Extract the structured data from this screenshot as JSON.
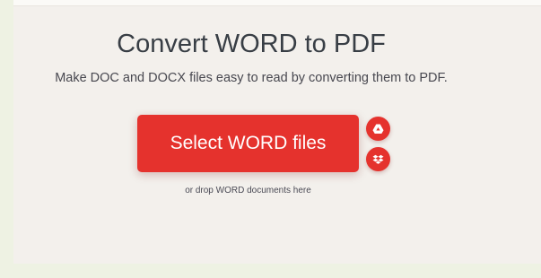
{
  "page": {
    "title": "Convert WORD to PDF",
    "subtitle": "Make DOC and DOCX files easy to read by converting them to PDF.",
    "select_button_label": "Select WORD files",
    "drop_hint": "or drop WORD documents here"
  },
  "icons": {
    "google_drive": "google-drive-icon",
    "dropbox": "dropbox-icon"
  },
  "colors": {
    "accent": "#e5322d",
    "background": "#f3f0ec",
    "title_text": "#383e45"
  }
}
